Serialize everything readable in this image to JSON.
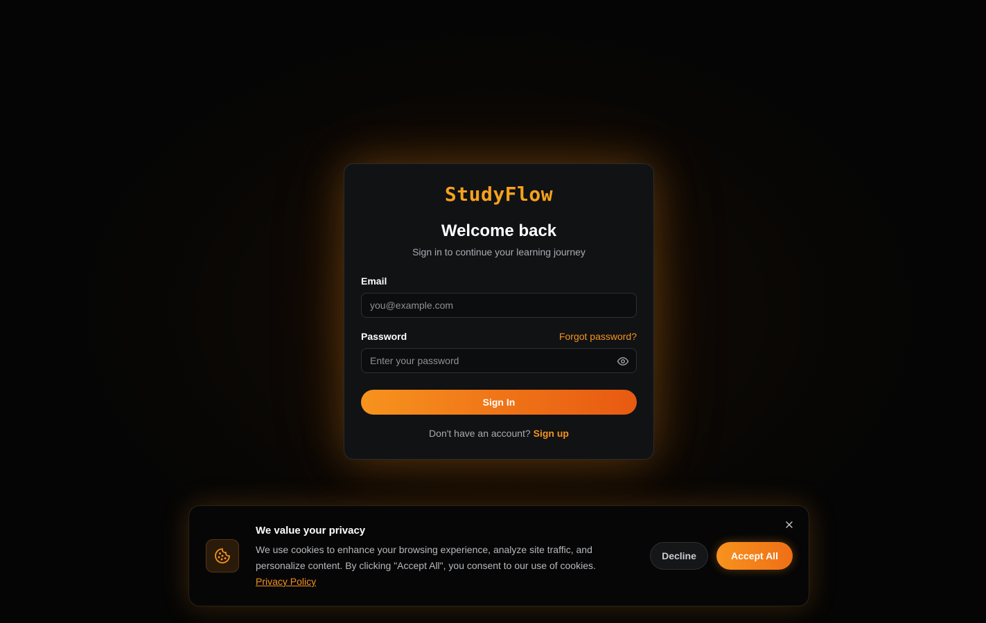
{
  "brand": {
    "name": "StudyFlow"
  },
  "login": {
    "title": "Welcome back",
    "subtitle": "Sign in to continue your learning journey",
    "email": {
      "label": "Email",
      "placeholder": "you@example.com",
      "value": ""
    },
    "password": {
      "label": "Password",
      "placeholder": "Enter your password",
      "value": "",
      "toggle_icon": "eye-icon"
    },
    "forgot_label": "Forgot password?",
    "submit_label": "Sign In",
    "signup_prompt": "Don't have an account?",
    "signup_link": "Sign up"
  },
  "cookie_banner": {
    "icon": "cookie-icon",
    "title": "We value your privacy",
    "body": "We use cookies to enhance your browsing experience, analyze site traffic, and personalize content. By clicking \"Accept All\", you consent to our use of cookies.",
    "privacy_link": "Privacy Policy",
    "decline_label": "Decline",
    "accept_label": "Accept All",
    "close_icon": "close-icon"
  },
  "colors": {
    "accent": "#f7931e",
    "accent_dark": "#e85a12",
    "card_bg": "#111214",
    "page_bg": "#050505"
  }
}
